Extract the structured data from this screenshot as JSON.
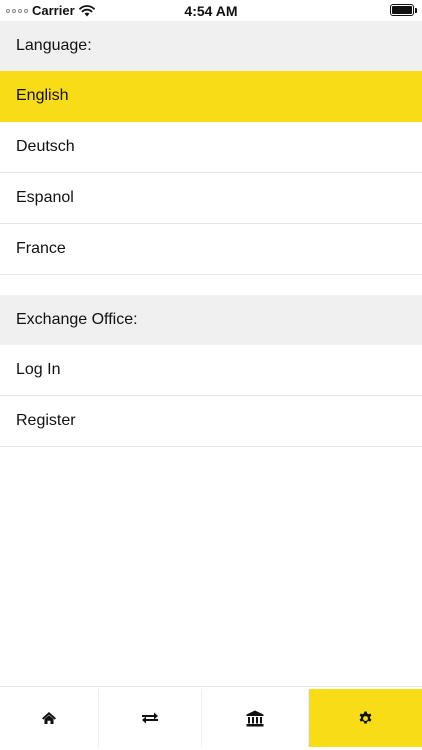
{
  "status_bar": {
    "carrier": "Carrier",
    "time": "4:54 AM"
  },
  "language_section": {
    "header": "Language:",
    "items": [
      "English",
      "Deutsch",
      "Espanol",
      "France"
    ],
    "selected": "English"
  },
  "exchange_section": {
    "header": "Exchange Office:",
    "items": [
      "Log In",
      "Register"
    ]
  },
  "tab_bar": {
    "tabs": [
      {
        "icon": "home-icon"
      },
      {
        "icon": "exchange-arrows-icon"
      },
      {
        "icon": "bank-icon"
      },
      {
        "icon": "gear-icon",
        "active": true
      }
    ]
  },
  "colors": {
    "accent": "#f8dc15",
    "section_bg": "#f0f0f0",
    "divider": "#e6e6e6"
  }
}
